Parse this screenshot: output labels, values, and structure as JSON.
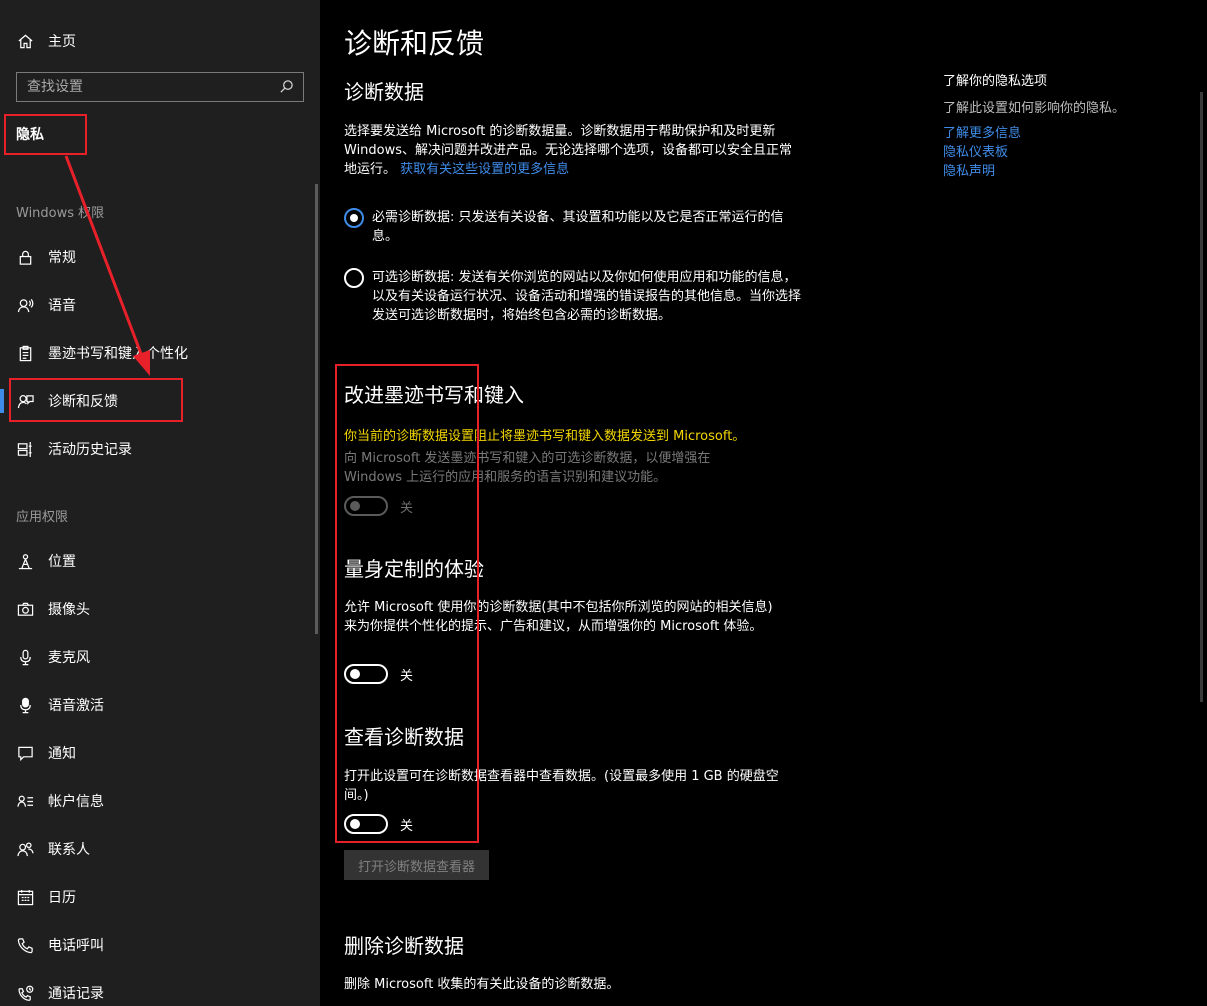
{
  "sidebar": {
    "home_label": "主页",
    "search_placeholder": "查找设置",
    "title": "隐私",
    "section_windows": "Windows 权限",
    "windows_items": [
      {
        "label": "常规",
        "icon": "lock-icon"
      },
      {
        "label": "语音",
        "icon": "speech-icon"
      },
      {
        "label": "墨迹书写和键入个性化",
        "icon": "clipboard-icon"
      },
      {
        "label": "诊断和反馈",
        "icon": "feedback-icon",
        "selected": true
      },
      {
        "label": "活动历史记录",
        "icon": "timeline-icon"
      }
    ],
    "section_apps": "应用权限",
    "app_items": [
      {
        "label": "位置",
        "icon": "location-icon"
      },
      {
        "label": "摄像头",
        "icon": "camera-icon"
      },
      {
        "label": "麦克风",
        "icon": "microphone-icon"
      },
      {
        "label": "语音激活",
        "icon": "voice-activation-icon"
      },
      {
        "label": "通知",
        "icon": "notification-icon"
      },
      {
        "label": "帐户信息",
        "icon": "account-info-icon"
      },
      {
        "label": "联系人",
        "icon": "contacts-icon"
      },
      {
        "label": "日历",
        "icon": "calendar-icon"
      },
      {
        "label": "电话呼叫",
        "icon": "phone-icon"
      },
      {
        "label": "通话记录",
        "icon": "call-history-icon"
      }
    ]
  },
  "main": {
    "page_title": "诊断和反馈",
    "diag_data": {
      "heading": "诊断数据",
      "description": "选择要发送给 Microsoft 的诊断数据量。诊断数据用于帮助保护和及时更新 Windows、解决问题并改进产品。无论选择哪个选项，设备都可以安全且正常地运行。",
      "link": "获取有关这些设置的更多信息",
      "option_required": "必需诊断数据: 只发送有关设备、其设置和功能以及它是否正常运行的信息。",
      "option_optional": "可选诊断数据: 发送有关你浏览的网站以及你如何使用应用和功能的信息，以及有关设备运行状况、设备活动和增强的错误报告的其他信息。当你选择发送可选诊断数据时，将始终包含必需的诊断数据。"
    },
    "ink": {
      "heading": "改进墨迹书写和键入",
      "warning": "你当前的诊断数据设置阻止将墨迹书写和键入数据发送到 Microsoft。",
      "description": "向 Microsoft 发送墨迹书写和键入的可选诊断数据，以便增强在 Windows 上运行的应用和服务的语言识别和建议功能。",
      "toggle_label": "关"
    },
    "tailored": {
      "heading": "量身定制的体验",
      "description": "允许 Microsoft 使用你的诊断数据(其中不包括你所浏览的网站的相关信息)来为你提供个性化的提示、广告和建议，从而增强你的 Microsoft 体验。",
      "toggle_label": "关"
    },
    "view": {
      "heading": "查看诊断数据",
      "description": "打开此设置可在诊断数据查看器中查看数据。(设置最多使用 1 GB 的硬盘空间。)",
      "toggle_label": "关",
      "button_label": "打开诊断数据查看器"
    },
    "delete": {
      "heading": "删除诊断数据",
      "description": "删除 Microsoft 收集的有关此设备的诊断数据。"
    }
  },
  "side_panel": {
    "title": "了解你的隐私选项",
    "description": "了解此设置如何影响你的隐私。",
    "links": [
      "了解更多信息",
      "隐私仪表板",
      "隐私声明"
    ]
  },
  "colors": {
    "accent": "#3f8ce8",
    "warning": "#f2d600",
    "annotation": "#e8202a"
  }
}
